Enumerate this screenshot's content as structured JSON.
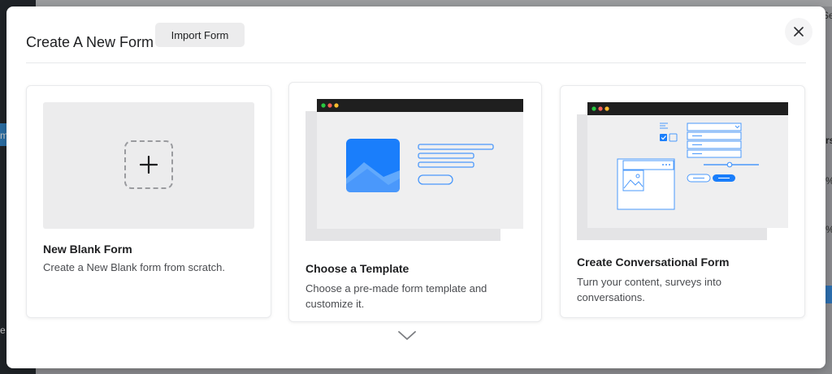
{
  "background": {
    "top_right_text": "Se",
    "right_texts": [
      "rs",
      "%",
      "%"
    ],
    "left_texts": [
      "m",
      "e"
    ]
  },
  "modal": {
    "title": "Create A New Form",
    "import_button": "Import Form",
    "close_icon": "close-icon"
  },
  "cards": [
    {
      "title": "New Blank Form",
      "description": "Create a New Blank form from scratch.",
      "icon": "plus-icon"
    },
    {
      "title": "Choose a Template",
      "description_line1": "Choose a pre-made form template and",
      "description_line2": "customize it.",
      "icon": "template-illustration"
    },
    {
      "title": "Create Conversational Form",
      "description_line1": "Turn your content, surveys into",
      "description_line2": "conversations.",
      "icon": "conversational-illustration"
    }
  ],
  "scroll_hint_icon": "chevron-down-icon",
  "colors": {
    "accent_blue": "#1a7efb",
    "window_bar": "#1f1f1f",
    "dot_red": "#fb5f57",
    "dot_yellow": "#fdbc2e",
    "dot_green": "#28c840"
  }
}
